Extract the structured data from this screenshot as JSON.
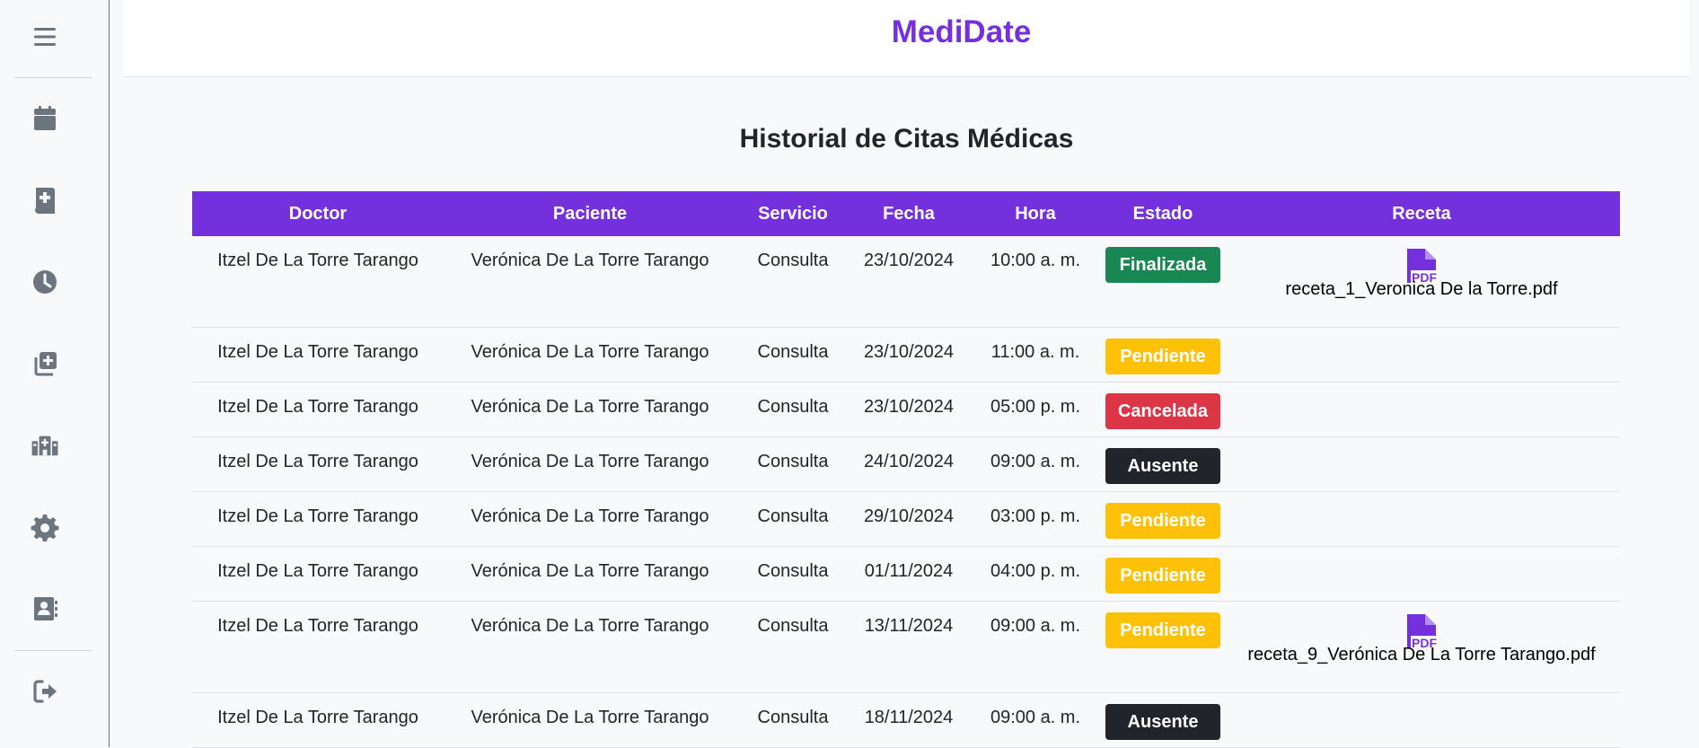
{
  "app": {
    "brand": "MediDate"
  },
  "page": {
    "title": "Historial de Citas Médicas"
  },
  "sidebar": {
    "items": [
      {
        "icon": "menu-icon"
      },
      {
        "icon": "calendar-icon"
      },
      {
        "icon": "medical-book-icon"
      },
      {
        "icon": "clock-icon"
      },
      {
        "icon": "add-copy-icon"
      },
      {
        "icon": "hospital-icon"
      },
      {
        "icon": "gear-icon"
      },
      {
        "icon": "contact-card-icon"
      },
      {
        "icon": "logout-icon"
      }
    ]
  },
  "table": {
    "headers": [
      "Doctor",
      "Paciente",
      "Servicio",
      "Fecha",
      "Hora",
      "Estado",
      "Receta"
    ],
    "rows": [
      {
        "doctor": "Itzel De La Torre Tarango",
        "paciente": "Verónica De La Torre Tarango",
        "servicio": "Consulta",
        "fecha": "23/10/2024",
        "hora": "10:00 a. m.",
        "estado": "Finalizada",
        "receta": "receta_1_Veronica De la Torre.pdf"
      },
      {
        "doctor": "Itzel De La Torre Tarango",
        "paciente": "Verónica De La Torre Tarango",
        "servicio": "Consulta",
        "fecha": "23/10/2024",
        "hora": "11:00 a. m.",
        "estado": "Pendiente",
        "receta": ""
      },
      {
        "doctor": "Itzel De La Torre Tarango",
        "paciente": "Verónica De La Torre Tarango",
        "servicio": "Consulta",
        "fecha": "23/10/2024",
        "hora": "05:00 p. m.",
        "estado": "Cancelada",
        "receta": ""
      },
      {
        "doctor": "Itzel De La Torre Tarango",
        "paciente": "Verónica De La Torre Tarango",
        "servicio": "Consulta",
        "fecha": "24/10/2024",
        "hora": "09:00 a. m.",
        "estado": "Ausente",
        "receta": ""
      },
      {
        "doctor": "Itzel De La Torre Tarango",
        "paciente": "Verónica De La Torre Tarango",
        "servicio": "Consulta",
        "fecha": "29/10/2024",
        "hora": "03:00 p. m.",
        "estado": "Pendiente",
        "receta": ""
      },
      {
        "doctor": "Itzel De La Torre Tarango",
        "paciente": "Verónica De La Torre Tarango",
        "servicio": "Consulta",
        "fecha": "01/11/2024",
        "hora": "04:00 p. m.",
        "estado": "Pendiente",
        "receta": ""
      },
      {
        "doctor": "Itzel De La Torre Tarango",
        "paciente": "Verónica De La Torre Tarango",
        "servicio": "Consulta",
        "fecha": "13/11/2024",
        "hora": "09:00 a. m.",
        "estado": "Pendiente",
        "receta": "receta_9_Verónica De La Torre Tarango.pdf"
      },
      {
        "doctor": "Itzel De La Torre Tarango",
        "paciente": "Verónica De La Torre Tarango",
        "servicio": "Consulta",
        "fecha": "18/11/2024",
        "hora": "09:00 a. m.",
        "estado": "Ausente",
        "receta": ""
      }
    ]
  },
  "colors": {
    "brand": "#7530dd",
    "finalizada": "#198754",
    "pendiente": "#ffc107",
    "cancelada": "#dc3545",
    "ausente": "#212529"
  }
}
